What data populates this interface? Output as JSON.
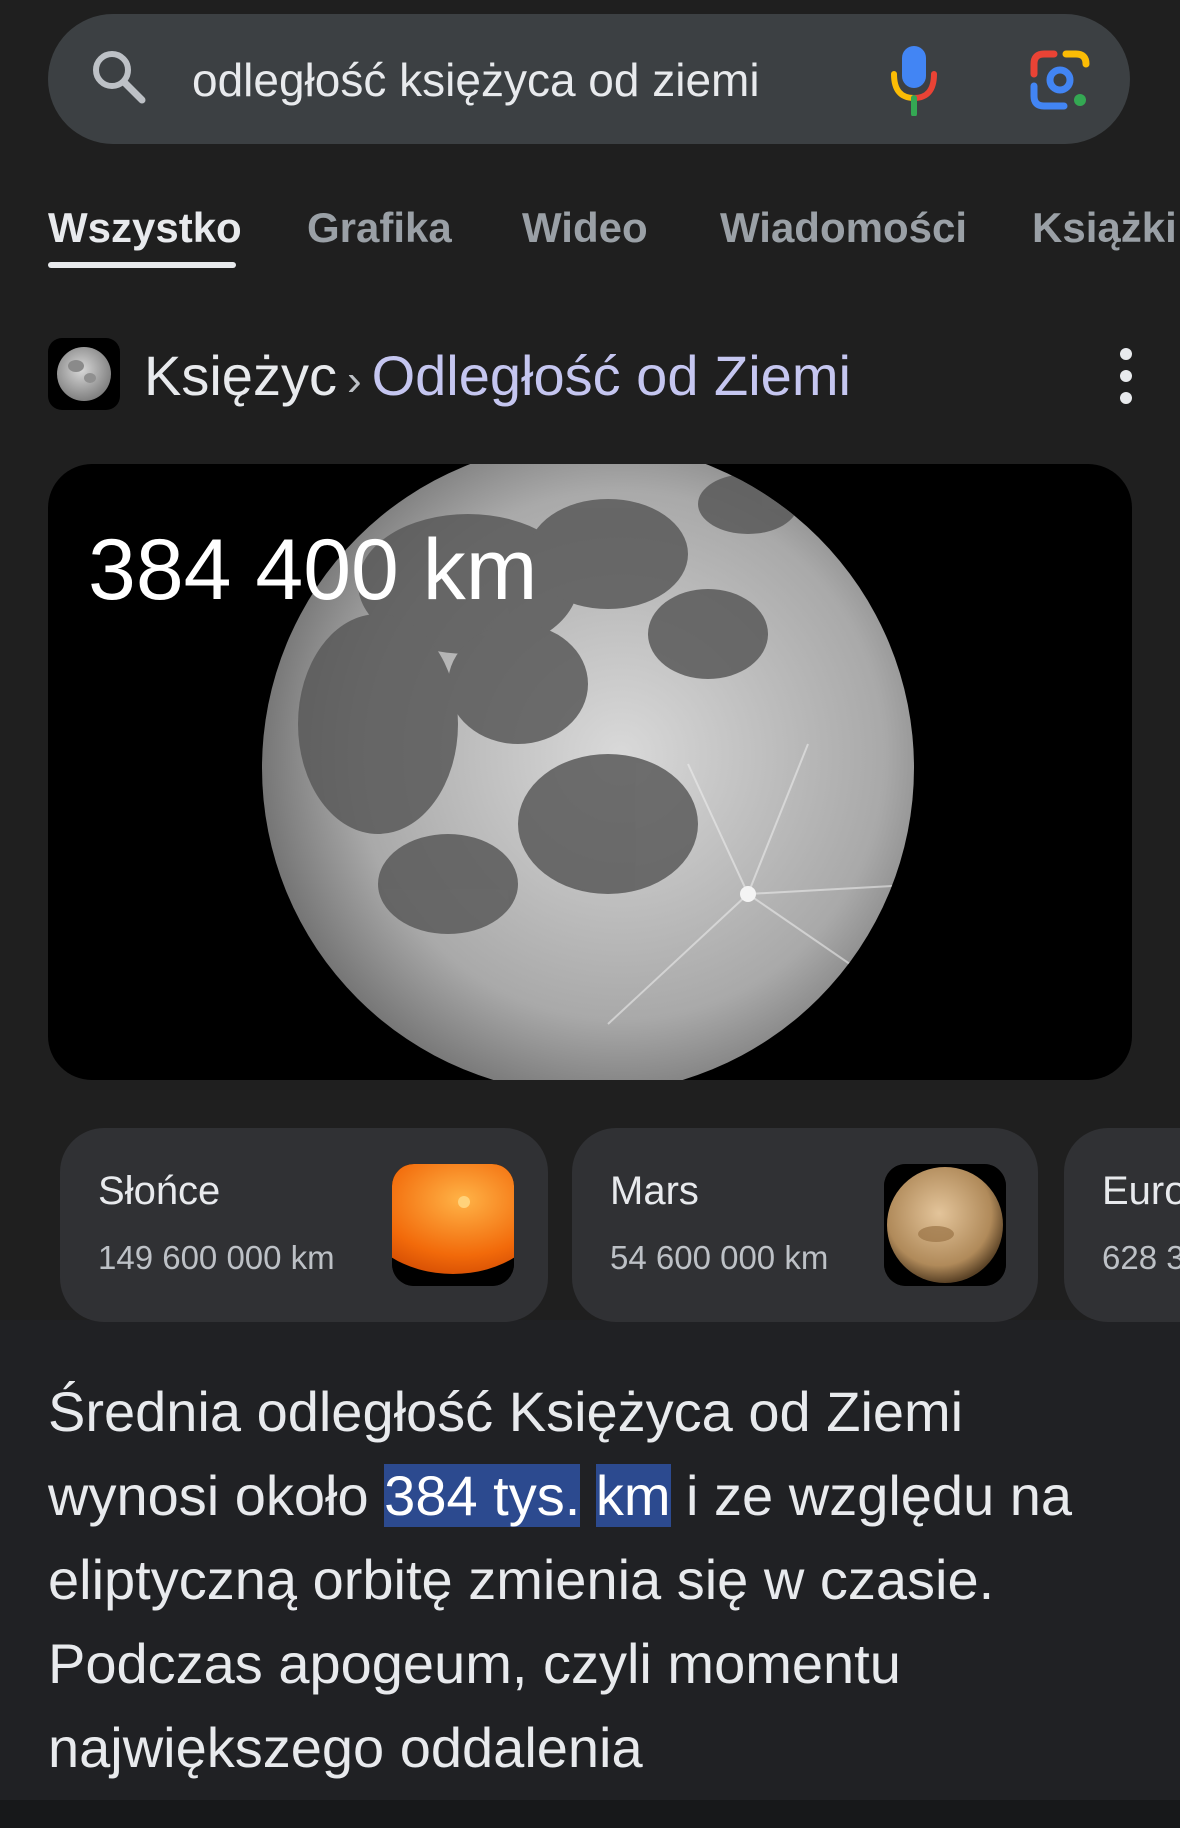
{
  "search": {
    "query": "odległość księżyca od ziemi"
  },
  "tabs": [
    {
      "label": "Wszystko",
      "active": true
    },
    {
      "label": "Grafika",
      "active": false
    },
    {
      "label": "Wideo",
      "active": false
    },
    {
      "label": "Wiadomości",
      "active": false
    },
    {
      "label": "Książki",
      "active": false
    }
  ],
  "breadcrumb": {
    "entity": "Księżyc",
    "separator": "›",
    "attribute": "Odległość od Ziemi"
  },
  "hero": {
    "distance": "384 400 km"
  },
  "related": [
    {
      "name": "Słońce",
      "value": "149 600 000 km",
      "icon": "sun-thumbnail"
    },
    {
      "name": "Mars",
      "value": "54 600 000 km",
      "icon": "mars-thumbnail"
    },
    {
      "name": "Euro",
      "value": "628 3",
      "icon": ""
    }
  ],
  "description": {
    "part1": "Średnia odległość Księżyca od Ziemi wynosi około ",
    "highlight1": "384 tys.",
    "space": " ",
    "highlight2": "km",
    "part2": " i ze względu na eliptyczną orbitę zmienia się w czasie. Podczas apogeum, czyli momentu największego oddalenia"
  },
  "colors": {
    "background": "#1f1f1f",
    "search_bar": "#3c4043",
    "card": "#303134",
    "highlight": "#2c4a8f",
    "breadcrumb_attribute": "#c5c6f0"
  }
}
